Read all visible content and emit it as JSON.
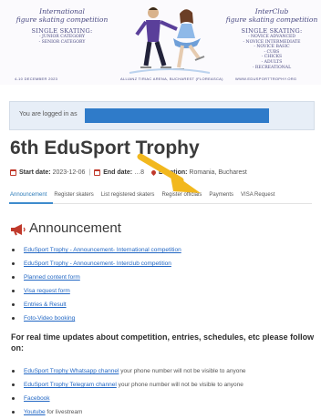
{
  "banner": {
    "left_script": [
      "International",
      "figure skating competition"
    ],
    "left_caps": "SINGLE SKATING:",
    "left_list": [
      "- JUNIOR CATEGORY",
      "- SENIOR CATEGORY"
    ],
    "right_script": [
      "InterClub",
      "figure skating competition"
    ],
    "right_caps": "SINGLE SKATING:",
    "right_list": [
      "- NOVICE ADVANCED",
      "- NOVICE INTERMEDIATE",
      "- NOVICE BASIC",
      "- CUBS",
      "- CHICKS",
      "- ADULTS",
      "- RECREATIONAL"
    ],
    "foot_left": "4-10 DECEMBER 2023",
    "foot_mid": "ALLIANZ TIRIAC ARENA, BUCHAREST (FLOREASCA)",
    "foot_right": "WWW.EDUSPORTTROPHY.ORG"
  },
  "login": {
    "text": "You are logged in as"
  },
  "event": {
    "title": "6th EduSport Trophy",
    "start_label": "Start date:",
    "start_value": "2023-12-06",
    "end_label": "End date:",
    "end_value": "…8",
    "location_label": "Location:",
    "location_value": "Romania, Bucharest"
  },
  "tabs": [
    {
      "label": "Announcement",
      "active": true
    },
    {
      "label": "Register skaters"
    },
    {
      "label": "List registered skaters"
    },
    {
      "label": "Register officials"
    },
    {
      "label": "Payments"
    },
    {
      "label": "VISA Request"
    }
  ],
  "announcement": {
    "heading": "Announcement",
    "links": [
      "EduSport Trophy - Announcement- International competition",
      "EduSport Trophy - Announcement- Interclub competition",
      "Planned content form",
      "Visa request form",
      "Entries & Result",
      "Foto-Video booking"
    ],
    "realtime_heading": "For real time updates about competition, entries, schedules, etc please follow on:",
    "social": [
      {
        "link": "EduSport Trophy Whatsapp channel",
        "note": " your phone number will not be visible to anyone"
      },
      {
        "link": "EduSport Trophy Telegram channel",
        "note": " your phone number will not be visible to anyone"
      },
      {
        "link": "Facebook",
        "note": ""
      },
      {
        "link": "Youtube",
        "note": " for livestream"
      }
    ]
  },
  "colors": {
    "accent": "#2a7ab8",
    "link": "#2267c4",
    "redaction": "#2f7bc9",
    "arrow": "#f2b81e",
    "icon": "#c0392b"
  }
}
